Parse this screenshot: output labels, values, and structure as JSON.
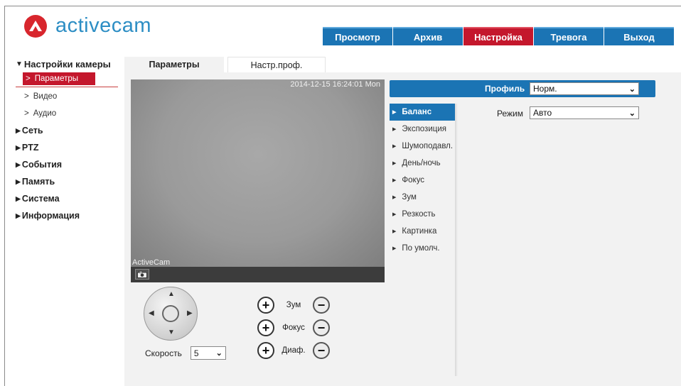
{
  "brand": {
    "name": "activecam",
    "logo_color": "#d8262d",
    "text_color": "#2d8ec4"
  },
  "topnav": [
    {
      "label": "Просмотр",
      "active": false
    },
    {
      "label": "Архив",
      "active": false
    },
    {
      "label": "Настройка",
      "active": true
    },
    {
      "label": "Тревога",
      "active": false
    },
    {
      "label": "Выход",
      "active": false
    }
  ],
  "sidebar": {
    "camera_settings": "Настройки камеры",
    "sub": [
      "Параметры",
      "Видео",
      "Аудио"
    ],
    "items": [
      "Сеть",
      "PTZ",
      "События",
      "Память",
      "Система",
      "Информация"
    ]
  },
  "content_tabs": [
    "Параметры",
    "Настр.проф."
  ],
  "video": {
    "timestamp": "2014-12-15 16:24:01 Mon",
    "watermark": "ActiveCam"
  },
  "ptz": {
    "speed_label": "Скорость",
    "speed_value": "5",
    "zoom_label": "Зум",
    "focus_label": "Фокус",
    "iris_label": "Диаф."
  },
  "settings": {
    "profile_label": "Профиль",
    "profile_value": "Норм.",
    "mode_label": "Режим",
    "mode_value": "Авто",
    "menu": [
      "Баланс",
      "Экспозиция",
      "Шумоподавл.",
      "День/ночь",
      "Фокус",
      "Зум",
      "Резкость",
      "Картинка",
      "По умолч."
    ]
  },
  "colors": {
    "accent_blue": "#1b74b4",
    "accent_red": "#c4172c"
  }
}
